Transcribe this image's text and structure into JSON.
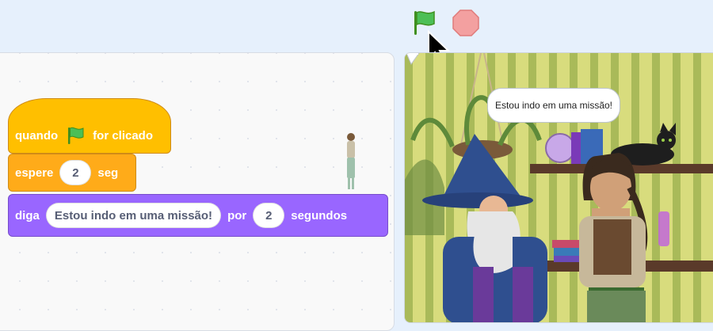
{
  "controls": {
    "green_flag_icon": "green-flag-icon",
    "stop_icon": "stop-sign-icon"
  },
  "code_blocks": {
    "hat": {
      "prefix": "quando",
      "suffix": "for clicado"
    },
    "wait": {
      "label": "espere",
      "value": "2",
      "unit": "seg"
    },
    "say": {
      "label": "diga",
      "message": "Estou indo em uma missão!",
      "connector": "por",
      "seconds": "2",
      "unit": "segundos"
    }
  },
  "stage": {
    "speech_bubble": "Estou indo em uma missão!"
  },
  "colors": {
    "events": "#ffbf00",
    "control": "#ffab19",
    "looks": "#9966ff",
    "background": "#e6f0fc"
  }
}
